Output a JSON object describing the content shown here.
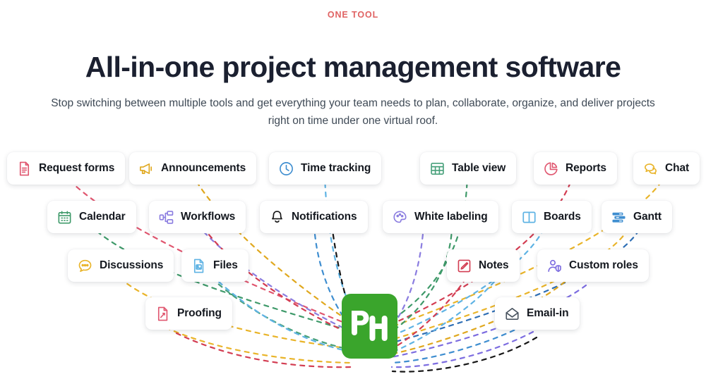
{
  "hero": {
    "eyebrow": "ONE TOOL",
    "headline": "All-in-one project management software",
    "subhead": "Stop switching between multiple tools and get everything your team needs to plan, collaborate, organize, and deliver projects right on time under one virtual roof."
  },
  "colors": {
    "brand_green": "#3aa52c",
    "eyebrow_red": "#e06363",
    "headline": "#1b2030",
    "subhead": "#3f4a56",
    "pink": "#e0566f",
    "crimson": "#d33d52",
    "yellow": "#e9b429",
    "gold": "#e0a81f",
    "blue": "#3f8ed0",
    "light_blue": "#5fb3e4",
    "dark_blue": "#2f6fb5",
    "green": "#3f9a6a",
    "teal_green": "#47a07a",
    "purple": "#8b7de0",
    "violet": "#7c6ce0",
    "black": "#171717",
    "gray": "#4a5460"
  },
  "logo": {
    "name": "ph-logo",
    "text": "PH",
    "color": "#3aa52c"
  },
  "features": [
    {
      "label": "Request forms",
      "icon": "document-lines-icon",
      "color": "#e0566f",
      "row": 1
    },
    {
      "label": "Announcements",
      "icon": "megaphone-icon",
      "color": "#e0a81f",
      "row": 1
    },
    {
      "label": "Time tracking",
      "icon": "clock-icon",
      "color": "#3f8ed0",
      "row": 1
    },
    {
      "label": "Table view",
      "icon": "table-grid-icon",
      "color": "#47a07a",
      "row": 1
    },
    {
      "label": "Reports",
      "icon": "pie-chart-icon",
      "color": "#e0566f",
      "row": 1
    },
    {
      "label": "Chat",
      "icon": "speech-bubbles-icon",
      "color": "#e9b429",
      "row": 1
    },
    {
      "label": "Calendar",
      "icon": "calendar-icon",
      "color": "#3f9a6a",
      "row": 2
    },
    {
      "label": "Workflows",
      "icon": "workflow-tree-icon",
      "color": "#8b7de0",
      "row": 2
    },
    {
      "label": "Notifications",
      "icon": "bell-icon",
      "color": "#171717",
      "row": 2
    },
    {
      "label": "White labeling",
      "icon": "palette-icon",
      "color": "#8b7de0",
      "row": 2
    },
    {
      "label": "Boards",
      "icon": "board-columns-icon",
      "color": "#5fb3e4",
      "row": 2
    },
    {
      "label": "Gantt",
      "icon": "gantt-bars-icon",
      "color": "#3f8ed0",
      "row": 2
    },
    {
      "label": "Discussions",
      "icon": "chat-dots-icon",
      "color": "#e9b429",
      "row": 3
    },
    {
      "label": "Files",
      "icon": "file-image-icon",
      "color": "#5fb3e4",
      "row": 3
    },
    {
      "label": "Notes",
      "icon": "note-pencil-icon",
      "color": "#d33d52",
      "row": 3
    },
    {
      "label": "Custom roles",
      "icon": "user-shield-icon",
      "color": "#7c6ce0",
      "row": 3
    },
    {
      "label": "Proofing",
      "icon": "proof-page-icon",
      "color": "#e0566f",
      "row": 4
    },
    {
      "label": "Email-in",
      "icon": "envelope-open-icon",
      "color": "#4a5460",
      "row": 4
    }
  ],
  "chart_data": {
    "type": "diagram",
    "title": "All-in-one project management software",
    "center_node": "PH",
    "node_count": 18,
    "nodes": [
      "Request forms",
      "Announcements",
      "Time tracking",
      "Table view",
      "Reports",
      "Chat",
      "Calendar",
      "Workflows",
      "Notifications",
      "White labeling",
      "Boards",
      "Gantt",
      "Discussions",
      "Files",
      "Notes",
      "Custom roles",
      "Proofing",
      "Email-in"
    ],
    "edge_style": "dashed-curve",
    "layout": "radial-fan-4-rows"
  }
}
